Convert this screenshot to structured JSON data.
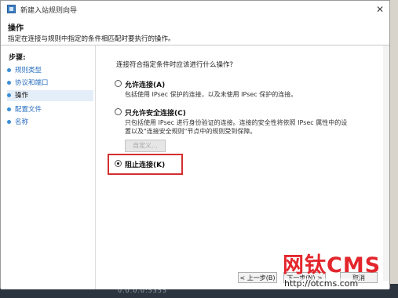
{
  "window": {
    "title": "新建入站规则向导",
    "close_glyph": "✕"
  },
  "header": {
    "title": "操作",
    "description": "指定在连接与规则中指定的条件相匹配时要执行的操作。"
  },
  "sidebar": {
    "steps_title": "步骤:",
    "items": [
      {
        "label": "规则类型",
        "state": "done"
      },
      {
        "label": "协议和端口",
        "state": "done"
      },
      {
        "label": "操作",
        "state": "current"
      },
      {
        "label": "配置文件",
        "state": "pending"
      },
      {
        "label": "名称",
        "state": "pending"
      }
    ]
  },
  "main": {
    "question": "连接符合指定条件时应该进行什么操作?",
    "options": [
      {
        "label": "允许连接(A)",
        "desc": [
          "包括使用 IPsec 保护的连接，以及未使用 IPsec 保护的连接。"
        ],
        "selected": false
      },
      {
        "label": "只允许安全连接(C)",
        "desc": [
          "只包括使用 IPsec 进行身份验证的连接。连接的安全性将依照 IPsec 属性中的设",
          "置以及\"连接安全规则\"节点中的规则受到保障。"
        ],
        "selected": false
      },
      {
        "label": "阻止连接(K)",
        "desc": [],
        "selected": true
      }
    ],
    "custom_button": "自定义..."
  },
  "buttons": {
    "back": "< 上一步(B)",
    "next": "下一步(N) >",
    "cancel": "取消"
  },
  "watermark": {
    "brand": "网钛CMS",
    "url": "http://otcms.com"
  },
  "taskbar": {
    "text": "0.0.0.0:5355"
  },
  "colors": {
    "highlight_border": "#d32f2f",
    "link_blue": "#2a6fc0",
    "watermark_red": "#e3262c"
  }
}
